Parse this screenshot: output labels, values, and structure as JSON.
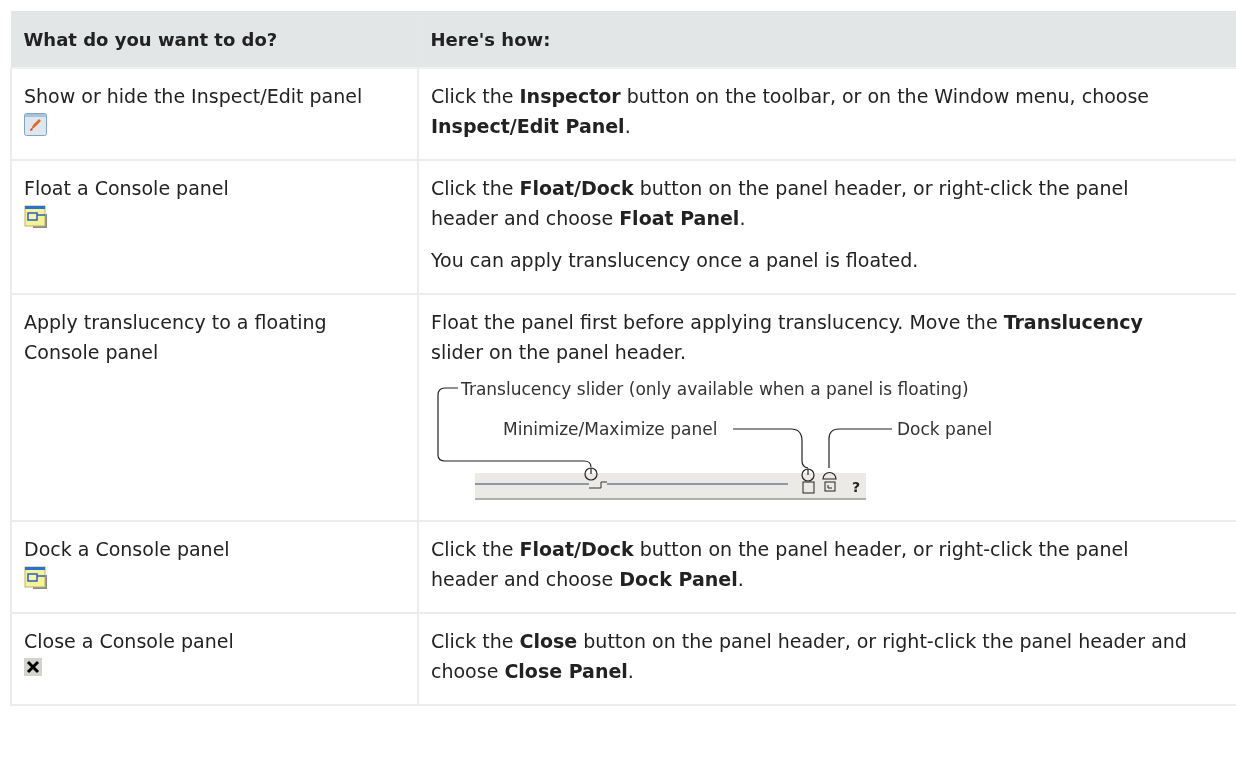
{
  "table": {
    "columns": [
      "What do you want to do?",
      "Here's how:"
    ],
    "rows": [
      {
        "task": "Show or hide the Inspect/Edit panel",
        "kind": "edit",
        "steps": [
          {
            "kind": "text",
            "text": "Click the **Inspector** button on the toolbar, or on the Window menu, choose **Inspect/Edit Panel**."
          }
        ]
      },
      {
        "task": "Float a Console panel",
        "kind": "float",
        "steps": [
          {
            "kind": "text",
            "text": "Click the **Float/Dock** button on the panel header, or right-click the panel header and choose **Float Panel**."
          },
          {
            "kind": "text",
            "text": "You can apply translucency once a panel is floated."
          }
        ]
      },
      {
        "task": "Apply translucency to a floating Console panel",
        "kind": "plain",
        "steps": [
          {
            "kind": "text",
            "text": "Float the panel first before applying translucency. Move the **Translucency** slider on the panel header."
          },
          {
            "kind": "diagram",
            "slider_label": "Translucency slider (only available when a panel is floating)",
            "minmax_label": "Minimize/Maximize panel",
            "dock_label": "Dock panel",
            "help_mark": "?"
          }
        ]
      },
      {
        "task": "Dock a Console panel",
        "kind": "float",
        "steps": [
          {
            "kind": "text",
            "text": "Click the **Float/Dock** button on the panel header, or right-click the panel header and choose **Dock Panel**."
          }
        ]
      },
      {
        "task": "Close a Console panel",
        "kind": "close",
        "steps": [
          {
            "kind": "text",
            "text": "Click the **Close** button on the panel header, or right-click the panel header and choose **Close Panel**."
          }
        ]
      }
    ]
  }
}
